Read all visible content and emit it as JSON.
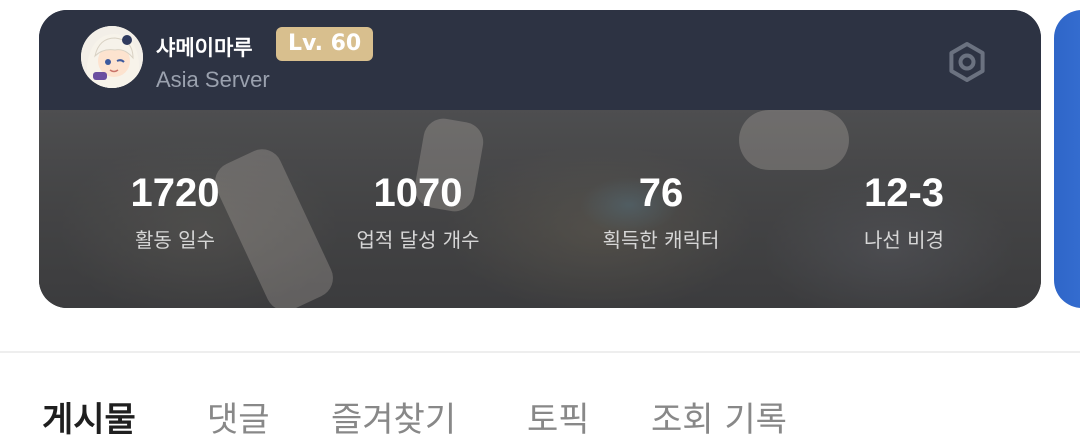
{
  "profile": {
    "username": "샤메이마루",
    "level": "Lv. 60",
    "server": "Asia Server"
  },
  "icons": {
    "avatar": "avatar-image",
    "settings": "settings-gear-icon"
  },
  "stats": [
    {
      "value": "1720",
      "label": "활동 일수"
    },
    {
      "value": "1070",
      "label": "업적 달성 개수"
    },
    {
      "value": "76",
      "label": "획득한 캐릭터"
    },
    {
      "value": "12-3",
      "label": "나선 비경"
    }
  ],
  "tabs": [
    {
      "label": "게시물",
      "active": true
    },
    {
      "label": "댓글",
      "active": false
    },
    {
      "label": "즐겨찾기",
      "active": false
    },
    {
      "label": "토픽",
      "active": false
    },
    {
      "label": "조회 기록",
      "active": false
    }
  ],
  "colors": {
    "card_header": "#2d3343",
    "level_badge": "#d8bf8e",
    "next_card": "#2f66c8",
    "tab_active": "#1f1f1f",
    "tab_inactive": "#888888"
  }
}
